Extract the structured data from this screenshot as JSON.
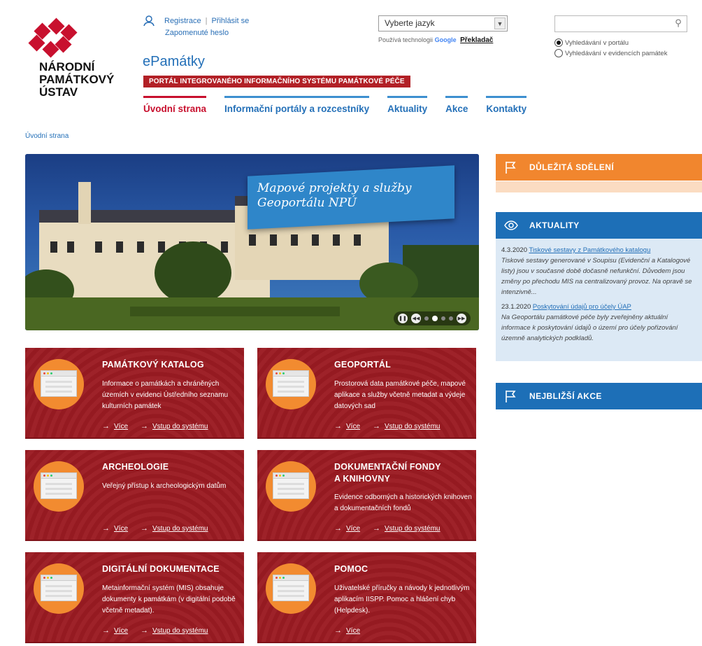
{
  "logo": {
    "line1": "NÁRODNÍ",
    "line2": "PAMÁTKOVÝ",
    "line3": "ÚSTAV"
  },
  "user": {
    "register": "Registrace",
    "separator": "|",
    "login": "Přihlásit se",
    "forgot": "Zapomenuté heslo"
  },
  "brand": "ePamátky",
  "portal_subtitle": "PORTÁL INTEGROVANÉHO INFORMAČNÍHO SYSTÉMU PAMÁTKOVÉ PÉČE",
  "nav": [
    {
      "label": "Úvodní strana"
    },
    {
      "label": "Informační portály a rozcestníky"
    },
    {
      "label": "Aktuality"
    },
    {
      "label": "Akce"
    },
    {
      "label": "Kontakty"
    }
  ],
  "language": {
    "selected": "Vyberte jazyk",
    "powered": "Používá technologii",
    "google": "Google",
    "translate": "Překladač"
  },
  "search": {
    "option_portal": "Vyhledávání v portálu",
    "option_registry": "Vyhledávání v evidencích památek"
  },
  "breadcrumb": "Úvodní strana",
  "hero": {
    "caption_line1": "Mapové projekty a služby",
    "caption_line2": "Geoportálu NPÚ"
  },
  "cards": [
    {
      "title": "PAMÁTKOVÝ KATALOG",
      "text": "Informace o památkách a chráněných územích v evidenci Ústředního seznamu kulturních památek",
      "more": "Více",
      "enter": "Vstup do systému"
    },
    {
      "title": "GEOPORTÁL",
      "text": "Prostorová data památkové péče, mapové aplikace a služby včetně metadat a výdeje datových sad",
      "more": "Více",
      "enter": "Vstup do systému"
    },
    {
      "title": "ARCHEOLOGIE",
      "text": "Veřejný přístup k archeologickým datům",
      "more": "Více",
      "enter": "Vstup do systému"
    },
    {
      "title": "DOKUMENTAČNÍ FONDY",
      "title2": "A KNIHOVNY",
      "text": "Evidence odborných a historických knihoven a dokumentačních fondů",
      "more": "Více",
      "enter": "Vstup do systému"
    },
    {
      "title": "DIGITÁLNÍ DOKUMENTACE",
      "text": "Metainformační systém (MIS) obsahuje dokumenty k památkám (v digitální podobě včetně metadat).",
      "more": "Více",
      "enter": "Vstup do systému"
    },
    {
      "title": "POMOC",
      "text": "Uživatelské příručky a návody k jednotlivým aplikacím IISPP. Pomoc a hlášení chyb (Helpdesk).",
      "more": "Více"
    }
  ],
  "sidebar": {
    "important": "DŮLEŽITÁ SDĚLENÍ",
    "news_title": "AKTUALITY",
    "news": [
      {
        "date": "4.3.2020",
        "link": "Tiskové sestavy z Památkového katalogu",
        "text": "Tiskové sestavy generované v Soupisu (Evidenční a Katalogové listy) jsou v současné době dočasně nefunkční. Důvodem jsou změny po přechodu MIS na centralizovaný provoz. Na opravě se intenzivně..."
      },
      {
        "date": "23.1.2020",
        "link": "Poskytování údajů pro účely ÚAP",
        "text": "Na Geoportálu památkové péče byly zveřejněny aktuální informace k poskytování údajů o území pro účely pořizování územně analytických podkladů."
      }
    ],
    "events": "NEJBLIŽŠÍ AKCE"
  },
  "colors": {
    "brand_red": "#9b1b22",
    "brand_blue": "#2470b8",
    "accent_orange": "#f1862e"
  }
}
